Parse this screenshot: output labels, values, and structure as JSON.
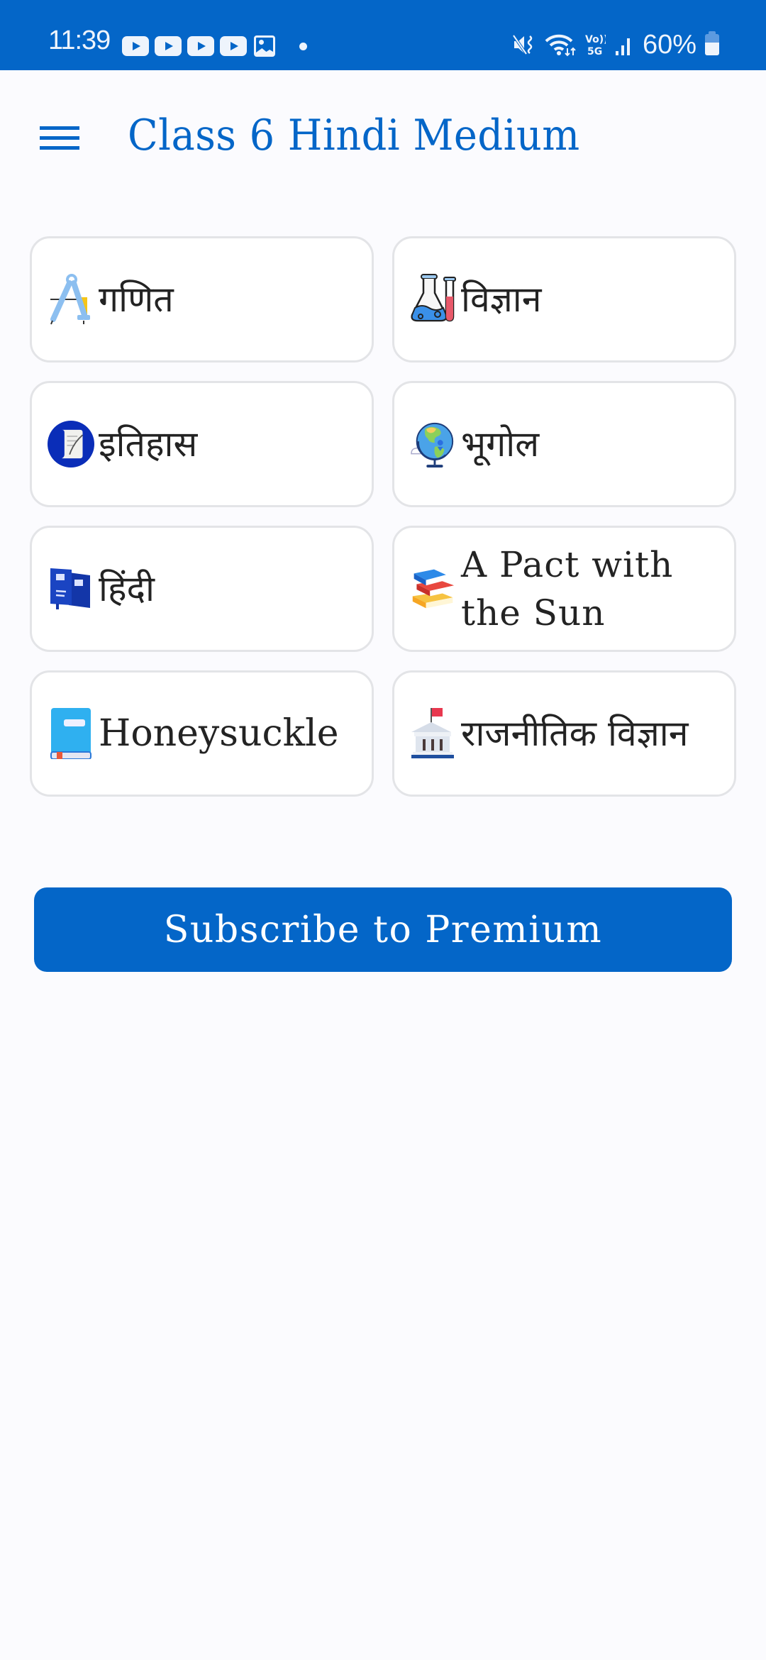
{
  "status_bar": {
    "time": "11:39",
    "notification_icons": [
      "youtube-icon",
      "youtube-icon",
      "youtube-icon",
      "youtube-icon",
      "gallery-icon",
      "dot-icon"
    ],
    "system_icons": [
      "mute-vibrate-icon",
      "wifi-icon",
      "volte-5g-icon",
      "signal-icon"
    ],
    "battery_percent": "60%",
    "battery_level": 0.6
  },
  "app_bar": {
    "title": "Class 6 Hindi Medium",
    "menu_icon": "hamburger-menu-icon"
  },
  "subjects": [
    {
      "label": "गणित",
      "icon": "compass-icon"
    },
    {
      "label": "विज्ञान",
      "icon": "flask-icon"
    },
    {
      "label": "इतिहास",
      "icon": "scroll-icon"
    },
    {
      "label": "भूगोल",
      "icon": "globe-icon"
    },
    {
      "label": "हिंदी",
      "icon": "books-icon"
    },
    {
      "label": "A Pact with the Sun",
      "icon": "book-stack-icon"
    },
    {
      "label": "Honeysuckle",
      "icon": "book-icon"
    },
    {
      "label": "राजनीतिक विज्ञान",
      "icon": "government-building-icon"
    }
  ],
  "subscribe_button": {
    "label": "Subscribe to Premium"
  },
  "colors": {
    "primary": "#0466c8",
    "background": "#fbfbfe",
    "card_border": "#e3e4e7",
    "text": "#232323"
  }
}
